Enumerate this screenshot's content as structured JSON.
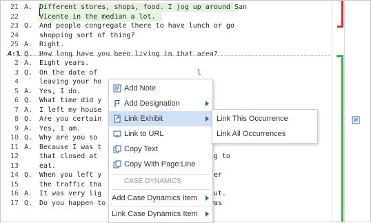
{
  "transcript": {
    "lines": [
      {
        "num": "21",
        "speaker": "A.",
        "text": "Different stores, shops, food. I jog up around San",
        "highlight": true
      },
      {
        "num": "22",
        "speaker": "",
        "text": "Vicente in the median a lot.",
        "highlight": true
      },
      {
        "num": "23",
        "speaker": "Q.",
        "text": "And people congregate there to have lunch or go"
      },
      {
        "num": "24",
        "speaker": "",
        "text": "shopping sort of thing?"
      },
      {
        "num": "25",
        "speaker": "A.",
        "text": "Right."
      },
      {
        "num": "4:1",
        "speaker": "Q.",
        "text": "How long have you been living in that area?",
        "page_start": true
      },
      {
        "num": "2",
        "speaker": "A.",
        "text": "Eight years."
      },
      {
        "num": "3",
        "speaker": "Q.",
        "text": "On the date of                        l"
      },
      {
        "num": "4",
        "speaker": "",
        "text": "leaving your ho"
      },
      {
        "num": "5",
        "speaker": "A.",
        "text": "Yes, I do."
      },
      {
        "num": "6",
        "speaker": "Q.",
        "text": "What time did y"
      },
      {
        "num": "7",
        "speaker": "A.",
        "text": "I left my house"
      },
      {
        "num": "8",
        "speaker": "Q.",
        "text": "Are you certain"
      },
      {
        "num": "9",
        "speaker": "A.",
        "text": "Yes, I am."
      },
      {
        "num": "10",
        "speaker": "Q.",
        "text": "Why are you so"
      },
      {
        "num": "11",
        "speaker": "A.",
        "text": "Because I was t"
      },
      {
        "num": "12",
        "speaker": "",
        "text": "that closed at                        thing to"
      },
      {
        "num": "13",
        "speaker": "",
        "text": "eat."
      },
      {
        "num": "14",
        "speaker": "Q.",
        "text": "When you left y                       hether"
      },
      {
        "num": "15",
        "speaker": "",
        "text": "the traffic tha"
      },
      {
        "num": "16",
        "speaker": "A.",
        "text": "It was very lig                       rs out."
      },
      {
        "num": "17",
        "speaker": "Q.",
        "text": "Do you happen to recall what the weather was"
      }
    ]
  },
  "context_menu": {
    "items": [
      {
        "label": "Add Note",
        "icon": "note-icon"
      },
      {
        "label": "Add Designation",
        "icon": "designation-flag-icon",
        "submenu": true
      },
      {
        "label": "Link Exhibit",
        "icon": "link-exhibit-icon",
        "submenu": true,
        "active": true
      },
      {
        "label": "Link to URL",
        "icon": "link-url-icon"
      },
      {
        "label": "Copy Text",
        "icon": "copy-icon"
      },
      {
        "label": "Copy With Page:Line",
        "icon": "copy-icon"
      }
    ],
    "section_header": "CASE DYNAMICS",
    "case_items": [
      {
        "label": "Add Case Dynamics Item",
        "submenu": true
      },
      {
        "label": "Link Case Dynamics Item",
        "submenu": true
      }
    ]
  },
  "submenu": {
    "items": [
      {
        "label": "Link This Occurrence"
      },
      {
        "label": "Link All Occurrences"
      }
    ]
  },
  "colors": {
    "highlight": "#e3f3df",
    "menu_active": "#cfe0f7",
    "red_bracket": "#e32626",
    "green_bracket": "#2fb148",
    "accent_blue": "#2f5fa8"
  }
}
